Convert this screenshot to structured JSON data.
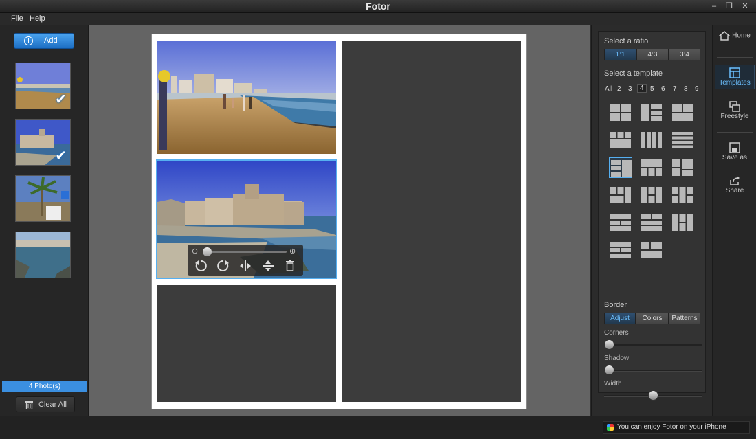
{
  "window": {
    "title": "Fotor",
    "minimize": "–",
    "restore": "❐",
    "close": "✕"
  },
  "menu": {
    "items": [
      "File",
      "Help"
    ]
  },
  "left_panel": {
    "add_label": "Add",
    "photo_count": "4 Photo(s)",
    "clear_label": "Clear All",
    "thumbnails": [
      {
        "name": "beach",
        "checked": true
      },
      {
        "name": "castle",
        "checked": true
      },
      {
        "name": "palm",
        "checked": false
      },
      {
        "name": "coast",
        "checked": false
      }
    ]
  },
  "canvas_toolbar": {
    "zoom_out": "⊖",
    "zoom_in": "⊕"
  },
  "right_panel": {
    "ratio_title": "Select a ratio",
    "ratios": [
      "1:1",
      "4:3",
      "3:4"
    ],
    "active_ratio": "1:1",
    "template_title": "Select a template",
    "counts": [
      "All",
      "2",
      "3",
      "4",
      "5",
      "6",
      "7",
      "8",
      "9"
    ],
    "active_count": "4",
    "border_title": "Border",
    "border_tabs": [
      "Adjust",
      "Colors",
      "Patterns"
    ],
    "active_border_tab": "Adjust",
    "sliders": [
      {
        "label": "Corners",
        "value": 0.0
      },
      {
        "label": "Shadow",
        "value": 0.0
      },
      {
        "label": "Width",
        "value": 0.5
      }
    ]
  },
  "nav": {
    "items": [
      {
        "label": "Home",
        "icon": "home-icon"
      },
      {
        "label": "Templates",
        "icon": "templates-icon"
      },
      {
        "label": "Freestyle",
        "icon": "freestyle-icon"
      },
      {
        "label": "Save as",
        "icon": "save-icon"
      },
      {
        "label": "Share",
        "icon": "share-icon"
      }
    ],
    "active": "Templates"
  },
  "status": {
    "message": "You can enjoy Fotor on your iPhone"
  },
  "colors": {
    "accent": "#3b8fe0",
    "highlight": "#56aff0",
    "panel": "#333333"
  }
}
